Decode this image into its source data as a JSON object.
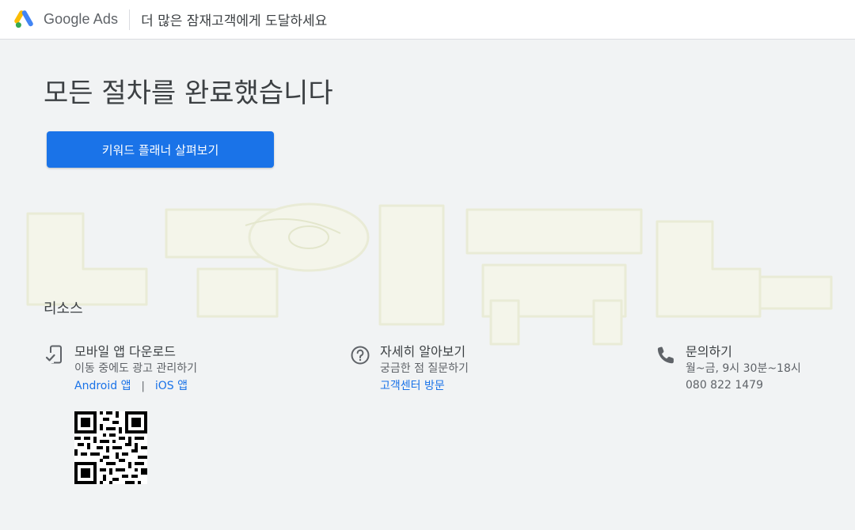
{
  "header": {
    "product_name": "Google Ads",
    "tagline": "더 많은 잠재고객에게 도달하세요",
    "logo_icon": "google-ads-logo-icon"
  },
  "main": {
    "heading": "모든 절차를 완료했습니다",
    "cta_label": "키워드 플래너 살펴보기"
  },
  "resources": {
    "title": "리소스",
    "mobile": {
      "icon": "mobile-download-icon",
      "title": "모바일 앱 다운로드",
      "subtitle": "이동 중에도 광고 관리하기",
      "android_link": "Android 앱",
      "separator": "|",
      "ios_link": "iOS 앱"
    },
    "help": {
      "icon": "help-circle-icon",
      "title": "자세히 알아보기",
      "subtitle": "궁금한 점 질문하기",
      "link": "고객센터 방문"
    },
    "contact": {
      "icon": "phone-icon",
      "title": "문의하기",
      "hours": "월~금, 9시 30분~18시",
      "phone": "080 822 1479"
    }
  },
  "colors": {
    "accent": "#1a73e8",
    "background": "#f1f3f4",
    "text": "#3c4043",
    "muted": "#5f6368"
  }
}
